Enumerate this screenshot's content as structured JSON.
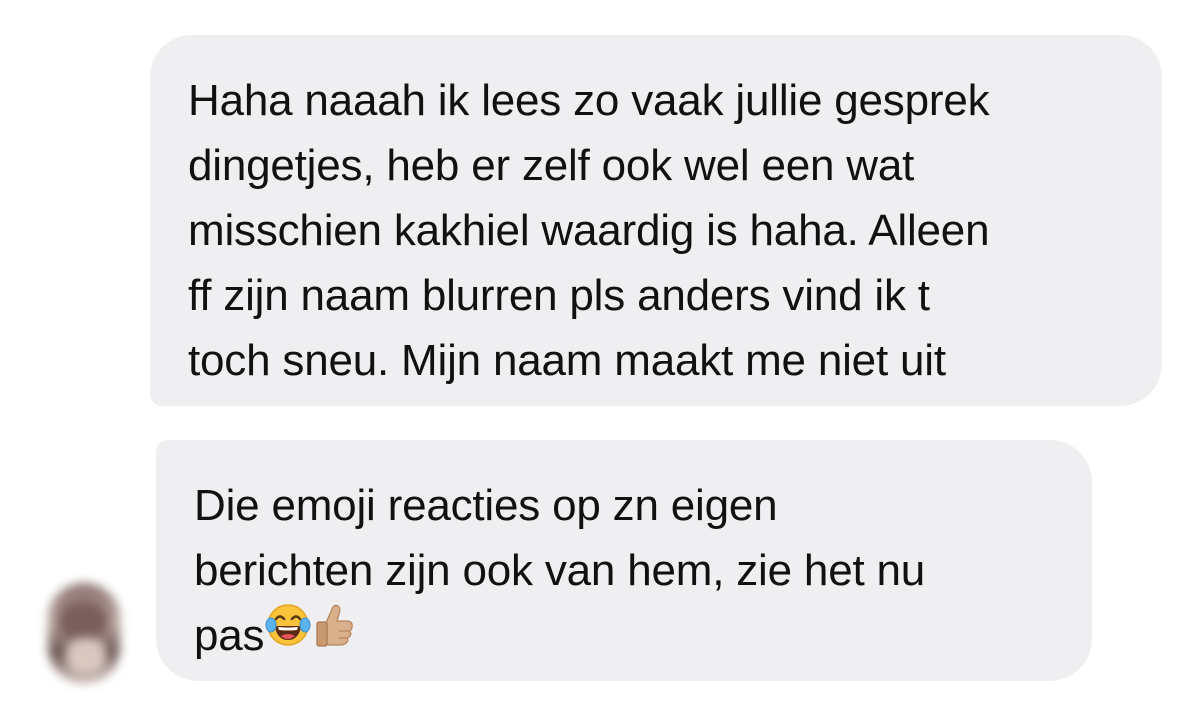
{
  "conversation": {
    "messages": [
      {
        "lines": [
          "Haha naaah ik lees zo vaak jullie gesprek",
          "dingetjes, heb er zelf ook wel een wat",
          "misschien kakhiel waardig is haha. Alleen",
          "ff zijn naam blurren pls anders vind ik t",
          "toch sneu. Mijn naam maakt me niet uit"
        ]
      },
      {
        "lines": [
          "Die emoji reacties op zn eigen",
          "berichten zijn ook van hem, zie het nu",
          "pas"
        ],
        "emojis": [
          "face-with-tears-of-joy",
          "thumbs-up-medium-light-skin"
        ]
      }
    ],
    "bubble_color": "#efeff1",
    "text_color": "#111111",
    "avatar": "blurred-profile-picture"
  }
}
